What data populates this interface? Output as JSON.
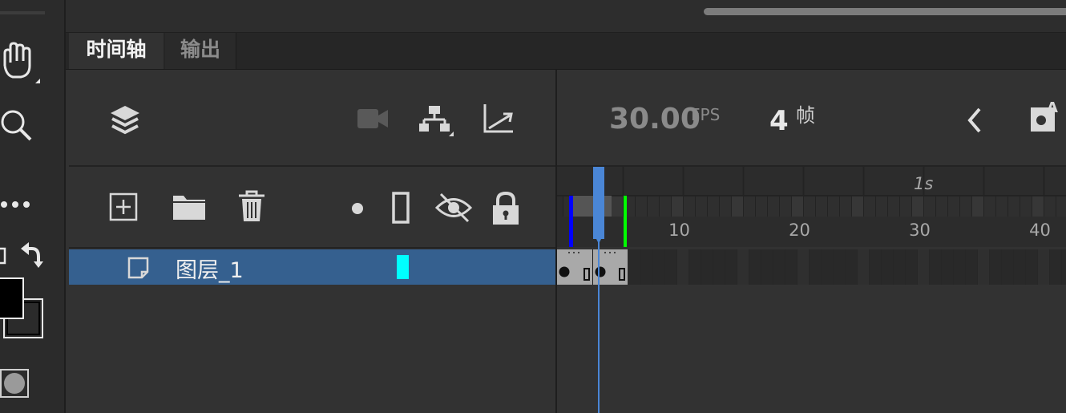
{
  "tabs": [
    {
      "label": "时间轴",
      "active": true
    },
    {
      "label": "输出",
      "active": false
    }
  ],
  "toolbar_left": {
    "tools": [
      "hand-tool-icon",
      "zoom-tool-icon",
      "more-tools-icon",
      "swap-colors-icon",
      "stroke-color-swatch",
      "fill-color-swatch",
      "object-drawing-icon"
    ],
    "stroke_color": "#000000",
    "fill_color": "#000000"
  },
  "layer_header": {
    "icons": [
      "layers-icon",
      "camera-icon",
      "parenting-icon",
      "easing-graph-icon"
    ]
  },
  "layer_controls": {
    "icons": [
      "new-layer-icon",
      "new-folder-icon",
      "delete-icon",
      "highlight-dot-icon",
      "outline-icon",
      "visibility-icon",
      "lock-icon"
    ]
  },
  "timeline": {
    "fps_value": "30.00",
    "fps_label": "FPS",
    "frame_value": "4",
    "frame_label": "帧",
    "current_frame": 4
  },
  "ruler": {
    "second_label": "1s",
    "labels": [
      "10",
      "20",
      "30",
      "40"
    ]
  },
  "layers": [
    {
      "name": "图层_1",
      "color": "#00ffff",
      "selected": true
    }
  ],
  "colors": {
    "accent": "#4a86d6",
    "selected_row": "#35608f",
    "onion_start": "#0000ff",
    "onion_end": "#00ff00"
  }
}
